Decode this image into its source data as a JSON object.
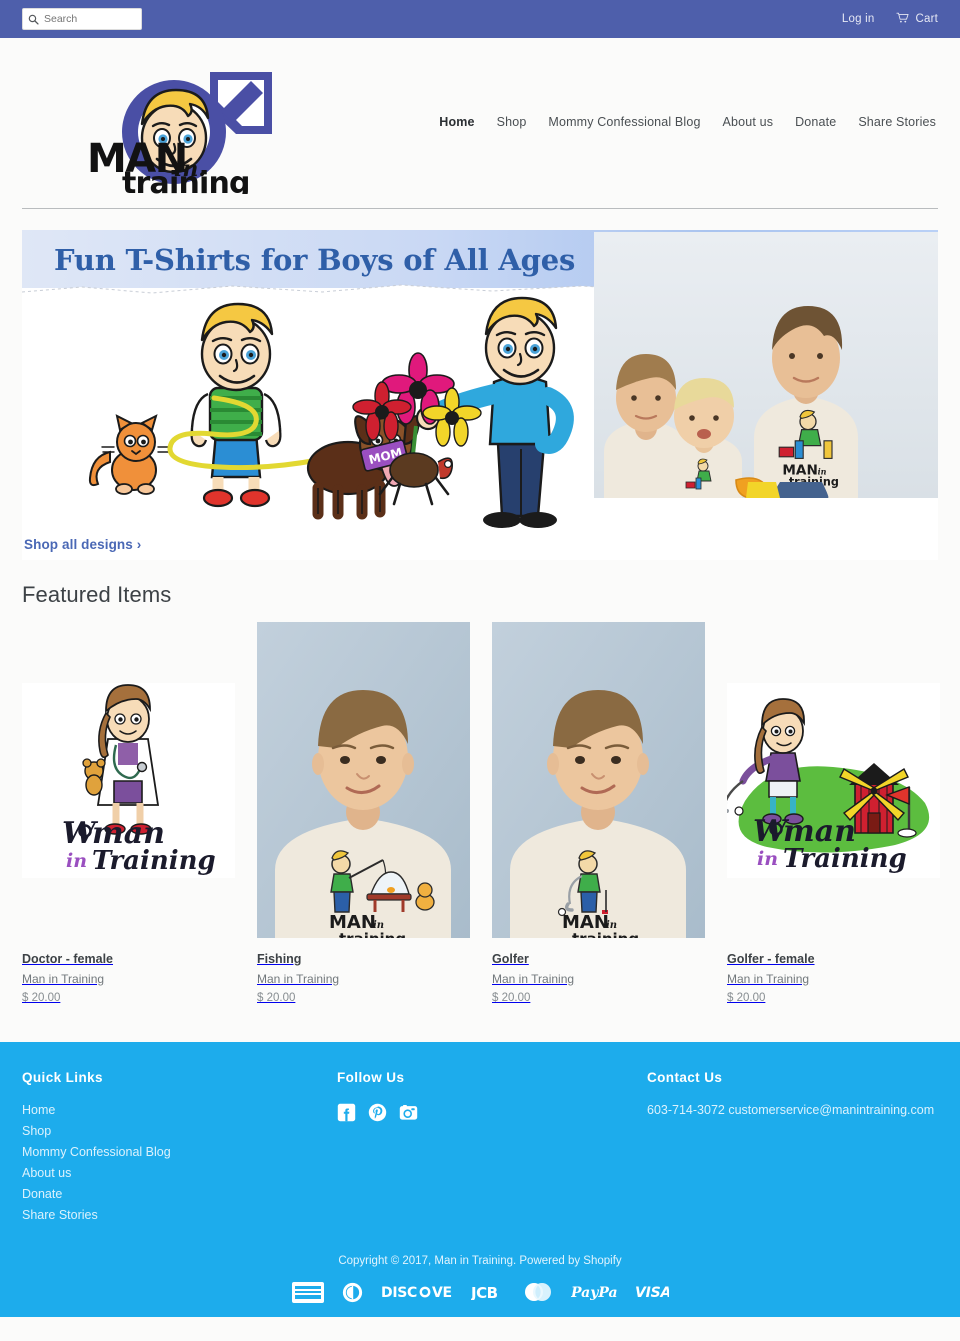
{
  "topbar": {
    "search_placeholder": "Search",
    "search_value": "",
    "search_icon": "search-icon",
    "login_label": "Log in",
    "cart_label": "Cart",
    "cart_icon": "cart-icon",
    "background_color": "#4e5fab"
  },
  "header": {
    "logo_text_main": "MAN",
    "logo_text_in": "in",
    "logo_text_bottom": "training",
    "nav": [
      {
        "label": "Home",
        "active": true
      },
      {
        "label": "Shop",
        "active": false
      },
      {
        "label": "Mommy Confessional Blog",
        "active": false
      },
      {
        "label": "About us",
        "active": false
      },
      {
        "label": "Donate",
        "active": false
      },
      {
        "label": "Share Stories",
        "active": false
      }
    ]
  },
  "hero": {
    "title": "Fun T-Shirts for Boys of All Ages",
    "title_color": "#2f5fa8",
    "shop_all_label": "Shop all designs ›",
    "shop_all_color": "#4a68b5",
    "mom_tag_label": "MOM"
  },
  "featured": {
    "heading": "Featured Items",
    "products": [
      {
        "title": "Doctor - female",
        "vendor": "Man in Training",
        "price": "$ 20.00",
        "art": "woman-doctor"
      },
      {
        "title": "Fishing",
        "vendor": "Man in Training",
        "price": "$ 20.00",
        "art": "boy-photo-fishing"
      },
      {
        "title": "Golfer",
        "vendor": "Man in Training",
        "price": "$ 20.00",
        "art": "boy-photo-golf"
      },
      {
        "title": "Golfer - female",
        "vendor": "Man in Training",
        "price": "$ 20.00",
        "art": "woman-golfer"
      }
    ],
    "shirt_text_main": "MAN",
    "shirt_text_in": "in",
    "shirt_text_bottom": "training",
    "woman_text_top": "W⊕man",
    "woman_text_in": "in",
    "woman_text_bottom": "Training"
  },
  "footer": {
    "background_color": "#1dacec",
    "quick_links": {
      "heading": "Quick Links",
      "items": [
        {
          "label": "Home"
        },
        {
          "label": "Shop"
        },
        {
          "label": "Mommy Confessional Blog"
        },
        {
          "label": "About us"
        },
        {
          "label": "Donate"
        },
        {
          "label": "Share Stories"
        }
      ]
    },
    "follow_us": {
      "heading": "Follow Us",
      "socials": [
        {
          "name": "facebook-icon",
          "label": "Facebook"
        },
        {
          "name": "pinterest-icon",
          "label": "Pinterest"
        },
        {
          "name": "instagram-icon",
          "label": "Instagram"
        }
      ]
    },
    "contact_us": {
      "heading": "Contact Us",
      "details": "603-714-3072 customerservice@manintraining.com"
    },
    "copyright": "Copyright © 2017, Man in Training. Powered by Shopify",
    "payments": [
      {
        "name": "amex-icon",
        "label": "AMERICAN EXPRESS"
      },
      {
        "name": "diners-club-icon",
        "label": "Diners Club"
      },
      {
        "name": "discover-icon",
        "label": "DISC⊕VER"
      },
      {
        "name": "jcb-icon",
        "label": "JCB"
      },
      {
        "name": "mastercard-icon",
        "label": "MasterCard"
      },
      {
        "name": "paypal-icon",
        "label": "PayPal"
      },
      {
        "name": "visa-icon",
        "label": "VISA"
      }
    ]
  }
}
